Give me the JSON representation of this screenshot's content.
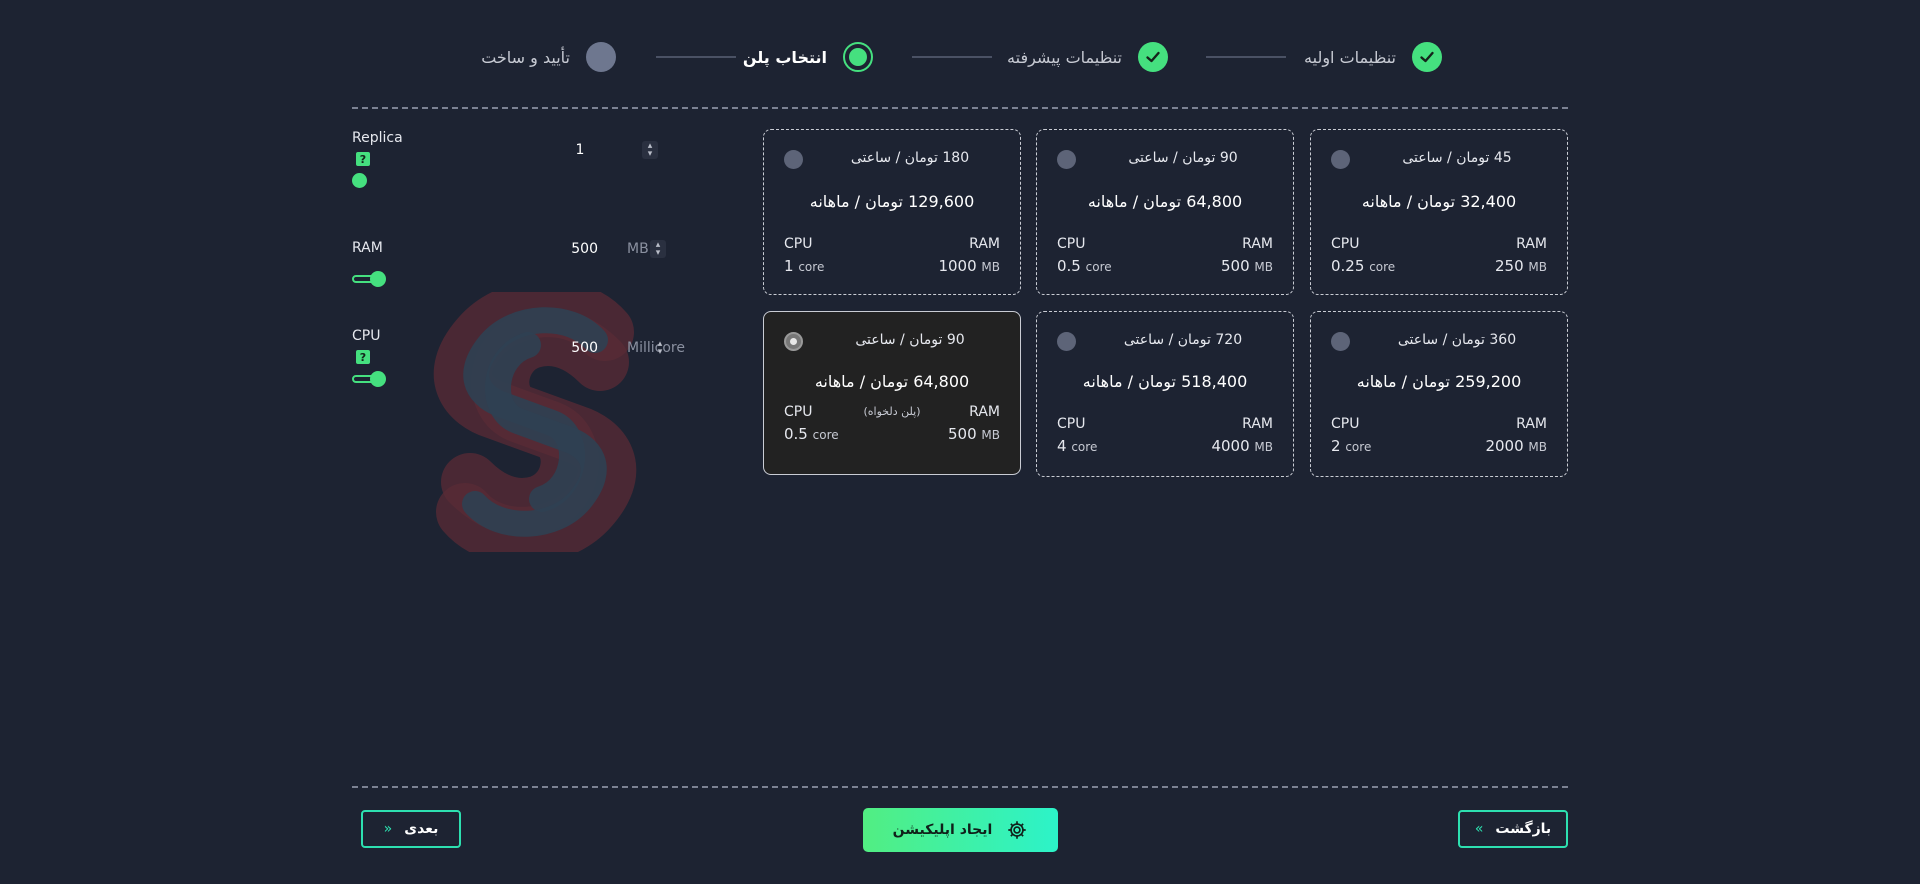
{
  "stepper": {
    "steps": [
      {
        "label": "تنظیمات اولیه",
        "state": "done"
      },
      {
        "label": "تنظیمات پیشرفته",
        "state": "done"
      },
      {
        "label": "انتخاب پلن",
        "state": "active"
      },
      {
        "label": "تأیید و ساخت",
        "state": "pending"
      }
    ]
  },
  "settings": {
    "replica": {
      "label": "Replica",
      "value": "1",
      "help": "?"
    },
    "ram": {
      "label": "RAM",
      "value": "500",
      "unit": "MB"
    },
    "cpu": {
      "label": "CPU",
      "value": "500",
      "unit": "Millicore",
      "help": "?"
    }
  },
  "plans": [
    {
      "hourly": "45 تومان / ساعتی",
      "monthly": "32,400 تومان / ماهانه",
      "cpu_label": "CPU",
      "cpu_value": "0.25",
      "cpu_unit": "core",
      "ram_label": "RAM",
      "ram_value": "250",
      "ram_unit": "MB"
    },
    {
      "hourly": "90 تومان / ساعتی",
      "monthly": "64,800 تومان / ماهانه",
      "cpu_label": "CPU",
      "cpu_value": "0.5",
      "cpu_unit": "core",
      "ram_label": "RAM",
      "ram_value": "500",
      "ram_unit": "MB"
    },
    {
      "hourly": "180 تومان / ساعتی",
      "monthly": "129,600 تومان / ماهانه",
      "cpu_label": "CPU",
      "cpu_value": "1",
      "cpu_unit": "core",
      "ram_label": "RAM",
      "ram_value": "1000",
      "ram_unit": "MB"
    },
    {
      "hourly": "360 تومان / ساعتی",
      "monthly": "259,200 تومان / ماهانه",
      "cpu_label": "CPU",
      "cpu_value": "2",
      "cpu_unit": "core",
      "ram_label": "RAM",
      "ram_value": "2000",
      "ram_unit": "MB"
    },
    {
      "hourly": "720 تومان / ساعتی",
      "monthly": "518,400 تومان / ماهانه",
      "cpu_label": "CPU",
      "cpu_value": "4",
      "cpu_unit": "core",
      "ram_label": "RAM",
      "ram_value": "4000",
      "ram_unit": "MB"
    },
    {
      "hourly": "90 تومان / ساعتی",
      "monthly": "64,800 تومان / ماهانه",
      "cpu_label": "CPU",
      "cpu_value": "0.5",
      "cpu_unit": "core",
      "ram_label": "RAM",
      "ram_value": "500",
      "ram_unit": "MB",
      "tag": "(پلن دلخواه)",
      "selected": true
    }
  ],
  "buttons": {
    "back": "بازگشت",
    "create": "ایجاد اپلیکیشن",
    "next": "بعدی"
  },
  "colors": {
    "accent": "#45e07f",
    "background": "#1d2332",
    "button_gradient_start": "#52ee82",
    "button_gradient_end": "#2cf3c9"
  },
  "icons": {
    "done_step": "check-icon",
    "create_button": "gear-icon",
    "back_button": "double-chevron-right-icon",
    "next_button": "double-chevron-left-icon"
  }
}
